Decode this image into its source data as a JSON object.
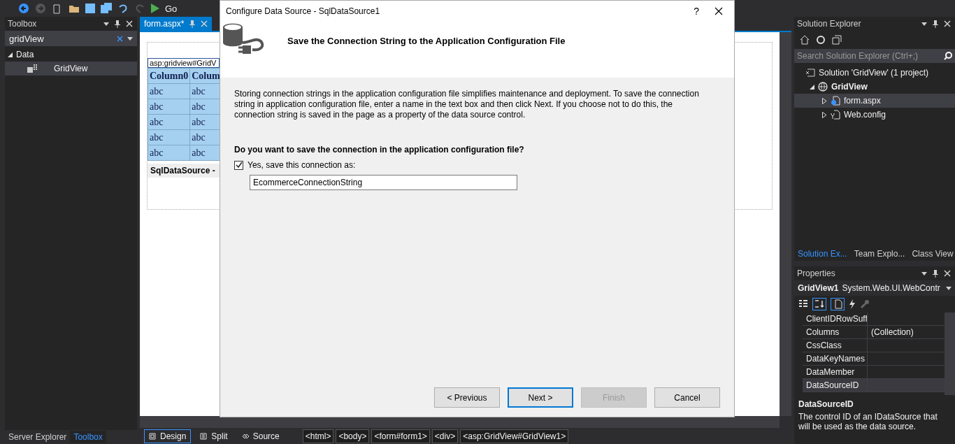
{
  "toolbar": {
    "run_label": "Go"
  },
  "toolbox": {
    "title": "Toolbox",
    "search": "gridView",
    "tree": [
      {
        "label": "Data",
        "expanded": true,
        "children": [
          {
            "label": "GridView",
            "selected": true
          }
        ]
      }
    ],
    "tabs": [
      {
        "label": "Server Explorer",
        "selected": false
      },
      {
        "label": "Toolbox",
        "selected": true
      }
    ]
  },
  "editor": {
    "tabs": [
      {
        "label": "form.aspx*",
        "selected": true
      }
    ],
    "gridview_tag": "asp:gridview#GridV",
    "grid": {
      "columns": [
        "Column0",
        "Colum"
      ],
      "rows": [
        [
          "abc",
          "abc"
        ],
        [
          "abc",
          "abc"
        ],
        [
          "abc",
          "abc"
        ],
        [
          "abc",
          "abc"
        ],
        [
          "abc",
          "abc"
        ]
      ]
    },
    "datasource_label": "SqlDataSource -",
    "view_tabs": [
      {
        "label": "Design",
        "selected": true
      },
      {
        "label": "Split",
        "selected": false
      },
      {
        "label": "Source",
        "selected": false
      }
    ],
    "breadcrumbs": [
      "<html>",
      "<body>",
      "<form#form1>",
      "<div>",
      "<asp:GridView#GridView1>"
    ]
  },
  "solution_explorer": {
    "title": "Solution Explorer",
    "search": {
      "placeholder": "Search Solution Explorer (Ctrl+;)"
    },
    "tree": [
      {
        "label": "Solution 'GridView' (1 project)",
        "kind": "solution",
        "selected": false,
        "children": [
          {
            "label": "GridView",
            "kind": "project",
            "expanded": true,
            "selected": false,
            "children": [
              {
                "label": "form.aspx",
                "kind": "page",
                "expanded": false,
                "selected": true
              },
              {
                "label": "Web.config",
                "kind": "config",
                "expanded": false,
                "selected": false
              }
            ]
          }
        ]
      }
    ],
    "tabs": [
      {
        "label": "Solution Ex...",
        "selected": true
      },
      {
        "label": "Team Explo...",
        "selected": false
      },
      {
        "label": "Class View",
        "selected": false
      }
    ]
  },
  "properties": {
    "title": "Properties",
    "object_name": "GridView1",
    "object_type": "System.Web.UI.WebContr",
    "rows": [
      {
        "name": "ClientIDRowSuff",
        "value": "",
        "selected": false
      },
      {
        "name": "Columns",
        "value": "(Collection)",
        "selected": false
      },
      {
        "name": "CssClass",
        "value": "",
        "selected": false
      },
      {
        "name": "DataKeyNames",
        "value": "",
        "selected": false
      },
      {
        "name": "DataMember",
        "value": "",
        "selected": false
      },
      {
        "name": "DataSourceID",
        "value": "",
        "selected": true
      }
    ],
    "description_title": "DataSourceID",
    "description": "The control ID of an IDataSource that will be used as the data source."
  },
  "dialog": {
    "title": "Configure Data Source - SqlDataSource1",
    "help": "?",
    "heading": "Save the Connection String to the Application Configuration File",
    "intro": "Storing connection strings in the application configuration file simplifies maintenance and deployment. To save the connection string in application configuration file, enter a name in the text box and then click Next. If you choose not to do this, the connection string is saved in the page as a property of the data source control.",
    "question": "Do you want to save the connection in the application configuration file?",
    "save_checkbox": {
      "label": "Yes, save this connection as:",
      "checked": true
    },
    "connection_name": "EcommerceConnectionString",
    "buttons": [
      {
        "label": "< Previous",
        "disabled": false,
        "default": false
      },
      {
        "label": "Next >",
        "disabled": false,
        "default": true
      },
      {
        "label": "Finish",
        "disabled": true,
        "default": false
      },
      {
        "label": "Cancel",
        "disabled": false,
        "default": false
      }
    ]
  }
}
